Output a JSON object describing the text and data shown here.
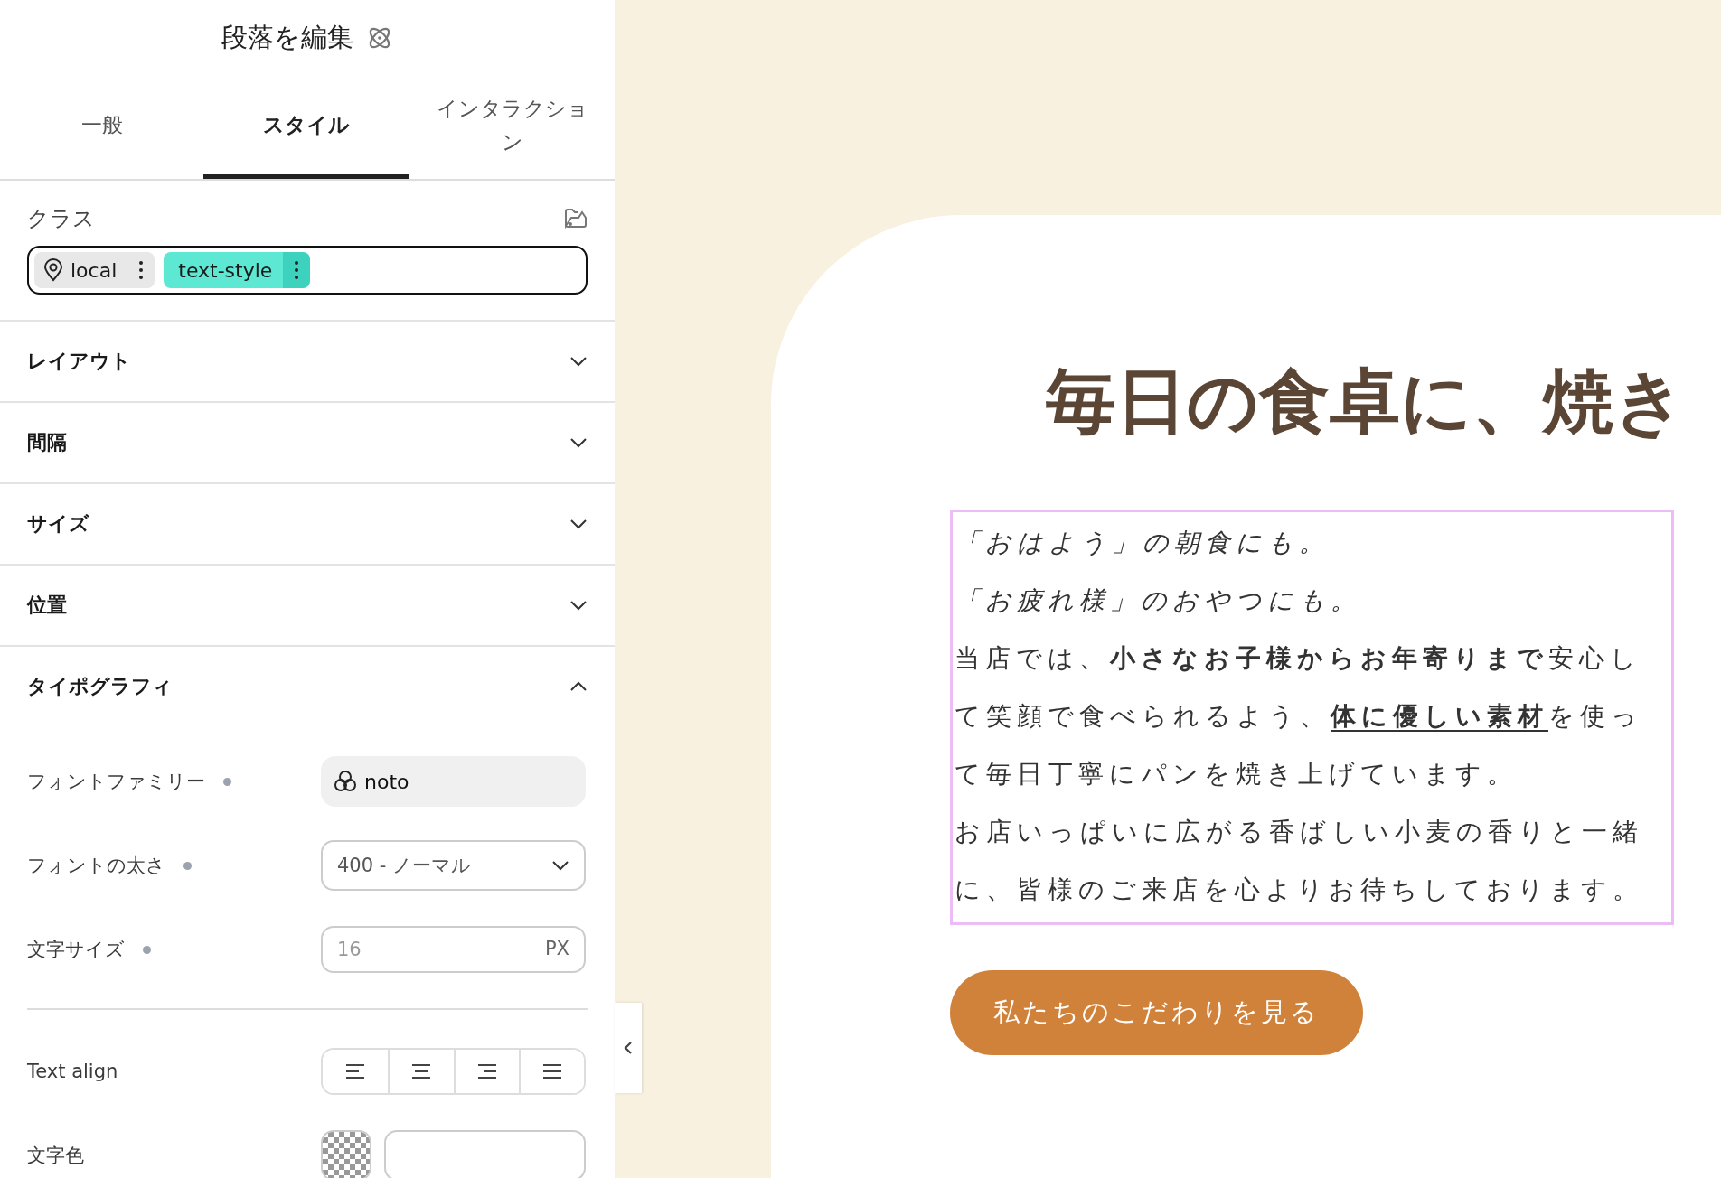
{
  "panel": {
    "title": "段落を編集",
    "tabs": [
      {
        "label": "一般",
        "selected": false
      },
      {
        "label": "スタイル",
        "selected": true
      },
      {
        "label": "インタラクション",
        "selected": false
      }
    ],
    "classes": {
      "label": "クラス",
      "chips": [
        {
          "label": "local",
          "kind": "location",
          "color": "#e8e8e8"
        },
        {
          "label": "text-style",
          "kind": "class",
          "color": "#5ce8d3"
        }
      ]
    },
    "sections": [
      {
        "label": "レイアウト",
        "expanded": false
      },
      {
        "label": "間隔",
        "expanded": false
      },
      {
        "label": "サイズ",
        "expanded": false
      },
      {
        "label": "位置",
        "expanded": false
      },
      {
        "label": "タイポグラフィ",
        "expanded": true
      }
    ],
    "typography": [
      {
        "kind": "font",
        "label": "フォントファミリー",
        "modified": true,
        "value": "noto"
      },
      {
        "kind": "select",
        "label": "フォントの太さ",
        "modified": true,
        "value": "400 - ノーマル"
      },
      {
        "kind": "unit",
        "label": "文字サイズ",
        "modified": true,
        "placeholder": "16",
        "unit": "PX"
      },
      {
        "kind": "align",
        "label": "Text align",
        "modified": false,
        "options": [
          {
            "selected": false
          },
          {
            "selected": false
          },
          {
            "selected": false
          },
          {
            "selected": false
          }
        ]
      },
      {
        "kind": "color",
        "label": "文字色",
        "modified": false
      }
    ]
  },
  "page": {
    "heading": "毎日の食卓に、焼き",
    "paragraph": {
      "selected": true,
      "lines": [
        [
          {
            "text": "「おはよう」の朝食にも。",
            "kind": "italic"
          }
        ],
        [
          {
            "text": "「お疲れ様」のおやつにも。",
            "kind": "italic"
          }
        ],
        [
          {
            "text": "当店では、",
            "kind": "plain"
          },
          {
            "text": "小さなお子様からお年寄りまで",
            "kind": "bold"
          },
          {
            "text": "安心し",
            "kind": "plain"
          }
        ],
        [
          {
            "text": "て笑顔で食べられるよう、",
            "kind": "plain"
          },
          {
            "text": "体に優しい素材",
            "kind": "underlined"
          },
          {
            "text": "を使っ",
            "kind": "plain"
          }
        ],
        [
          {
            "text": "て毎日丁寧にパンを焼き上げています。",
            "kind": "plain"
          }
        ],
        [
          {
            "text": "お店いっぱいに広がる香ばしい小麦の香りと一緒",
            "kind": "plain"
          }
        ],
        [
          {
            "text": "に、皆様のご来店を心よりお待ちしております。",
            "kind": "plain"
          }
        ]
      ]
    },
    "button": "私たちのこだわりを見る"
  }
}
